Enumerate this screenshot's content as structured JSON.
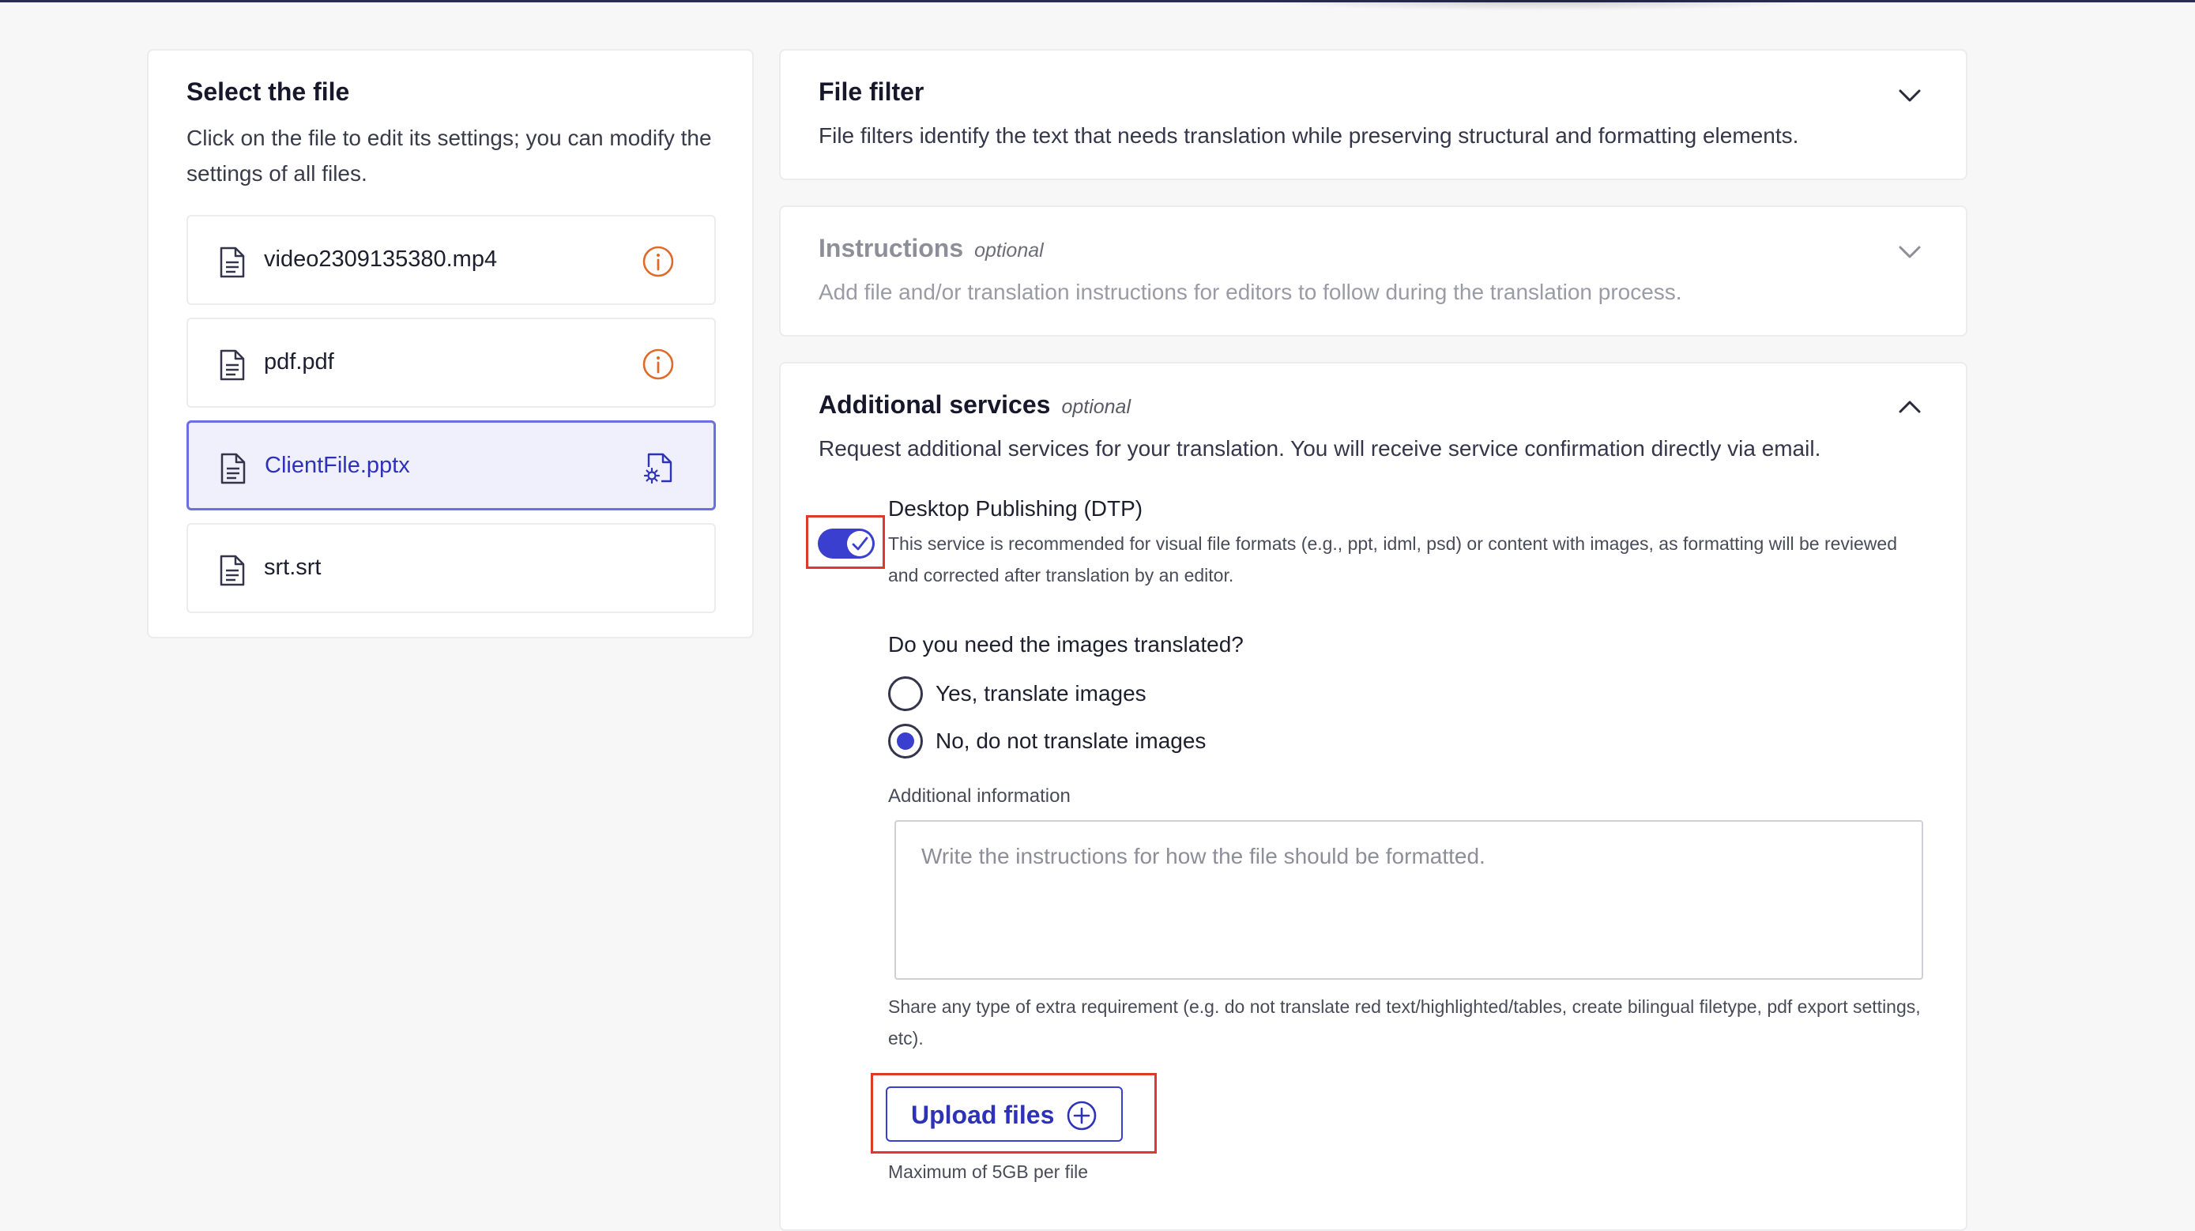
{
  "select_file": {
    "title": "Select the file",
    "description": "Click on the file to edit its settings; you can modify the settings of all files.",
    "files": [
      {
        "name": "video2309135380.mp4",
        "status_icon": "info-icon",
        "selected": false
      },
      {
        "name": "pdf.pdf",
        "status_icon": "info-icon",
        "selected": false
      },
      {
        "name": "ClientFile.pptx",
        "status_icon": "file-settings-icon",
        "selected": true
      },
      {
        "name": "srt.srt",
        "status_icon": "",
        "selected": false
      }
    ]
  },
  "file_filter": {
    "title": "File filter",
    "description": "File filters identify the text that needs translation while preserving structural and formatting elements.",
    "chevron_icon": "chevron-down-icon"
  },
  "instructions": {
    "title": "Instructions",
    "optional": "optional",
    "description": "Add file and/or translation instructions for editors to follow during the translation process.",
    "chevron_icon": "chevron-down-icon"
  },
  "additional_services": {
    "title": "Additional services",
    "optional": "optional",
    "description": "Request additional services for your translation. You will receive service confirmation directly via email.",
    "chevron_icon": "chevron-up-icon",
    "dtp": {
      "enabled": true,
      "title": "Desktop Publishing (DTP)",
      "description": "This service is recommended for visual file formats (e.g., ppt, idml, psd) or content with images, as formatting will be reviewed and corrected after translation by an editor."
    },
    "images_question": "Do you need the images translated?",
    "images_options": [
      {
        "label": "Yes, translate images",
        "selected": false
      },
      {
        "label": "No, do not translate images",
        "selected": true
      }
    ],
    "additional_info_label": "Additional information",
    "additional_info_placeholder": "Write the instructions for how the file should be formatted.",
    "additional_info_value": "",
    "share_note": "Share any type of extra requirement (e.g. do not translate red text/highlighted/tables, create bilingual filetype, pdf export settings, etc).",
    "upload_label": "Upload files",
    "upload_icon": "plus-circle-icon",
    "max_note": "Maximum of 5GB per file"
  },
  "colors": {
    "accent": "#3b3fd0",
    "warning": "#e06a2c",
    "highlight": "#e0382c"
  }
}
